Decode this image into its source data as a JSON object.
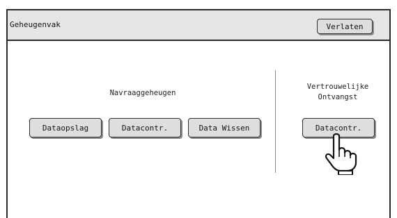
{
  "window": {
    "title": "Geheugenvak",
    "exit_label": "Verlaten"
  },
  "sections": {
    "navraag": {
      "label": "Navraaggeheugen",
      "buttons": [
        "Dataopslag",
        "Datacontr.",
        "Data Wissen"
      ]
    },
    "vertrouwelijk": {
      "label_line1": "Vertrouwelijke",
      "label_line2": "Ontvangst",
      "button": "Datacontr."
    }
  },
  "cursor_icon": "pointing-hand-icon"
}
